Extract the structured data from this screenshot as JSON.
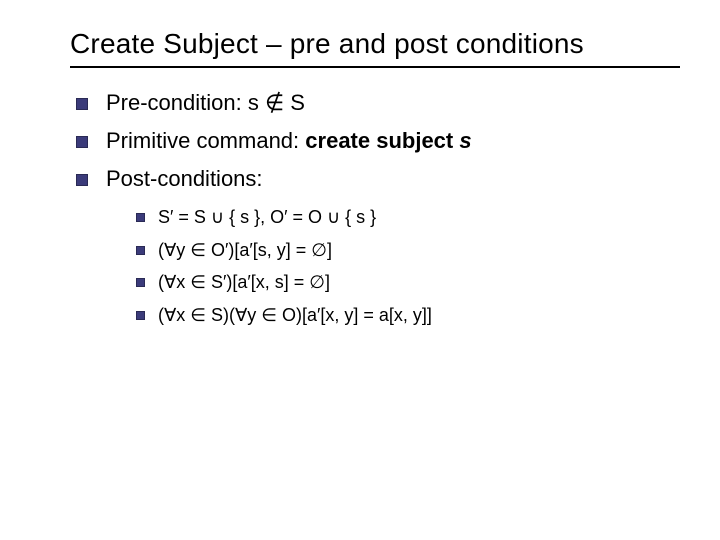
{
  "title": "Create Subject – pre and post conditions",
  "bullets": {
    "b1_prefix": "Pre-condition: s ",
    "b1_notin": "∉",
    "b1_suffix": " S",
    "b2_prefix": "Primitive command: ",
    "b2_bold": "create subject ",
    "b2_italic": "s",
    "b3": "Post-conditions:"
  },
  "sub": {
    "s1": "S′ = S ∪ { s }, O′ = O ∪ { s }",
    "s2": "(∀y ∈ O′)[a′[s, y] = ∅]",
    "s3": "(∀x ∈ S′)[a′[x, s] = ∅]",
    "s4": "(∀x ∈ S)(∀y ∈ O)[a′[x, y] = a[x, y]]"
  }
}
